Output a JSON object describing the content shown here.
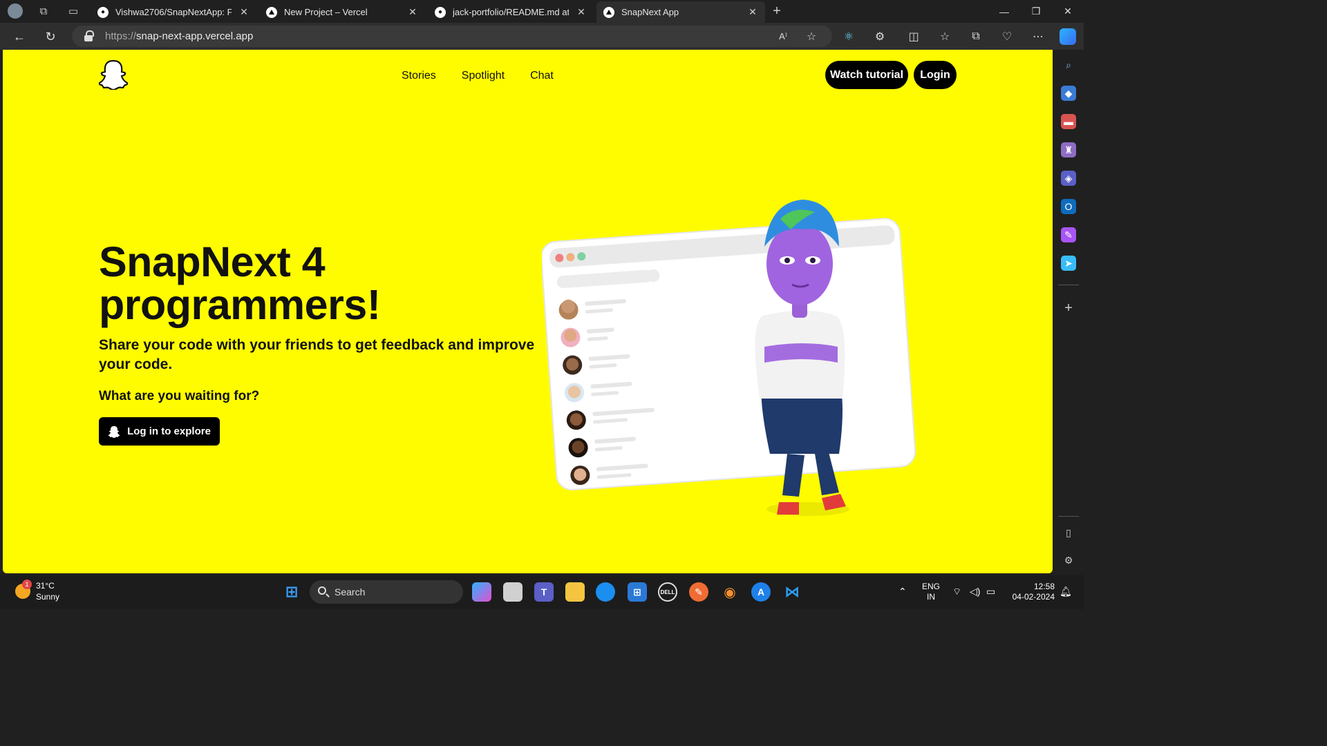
{
  "browser": {
    "tabs": [
      {
        "title": "Vishwa2706/SnapNextApp: Full S",
        "favicon": "github-icon",
        "active": false
      },
      {
        "title": "New Project – Vercel",
        "favicon": "vercel-icon",
        "active": false
      },
      {
        "title": "jack-portfolio/README.md at ma",
        "favicon": "github-icon",
        "active": false
      },
      {
        "title": "SnapNext App",
        "favicon": "vercel-icon",
        "active": true
      }
    ],
    "url_protocol": "https://",
    "url_host": "snap-next-app.vercel.app"
  },
  "page": {
    "nav": {
      "stories": "Stories",
      "spotlight": "Spotlight",
      "chat": "Chat"
    },
    "watch_tutorial": "Watch tutorial",
    "login": "Login",
    "hero_title_line1": "SnapNext 4",
    "hero_title_line2": "programmers!",
    "hero_subtitle": "Share your code with your friends to get feedback and improve your code.",
    "hero_question": "What are you waiting for?",
    "cta_label": "Log in to explore",
    "accent_color": "#FFFC00"
  },
  "taskbar": {
    "weather_temp": "31°C",
    "weather_desc": "Sunny",
    "weather_badge": "1",
    "search_placeholder": "Search",
    "lang_line1": "ENG",
    "lang_line2": "IN",
    "time": "12:58",
    "date": "04-02-2024"
  }
}
